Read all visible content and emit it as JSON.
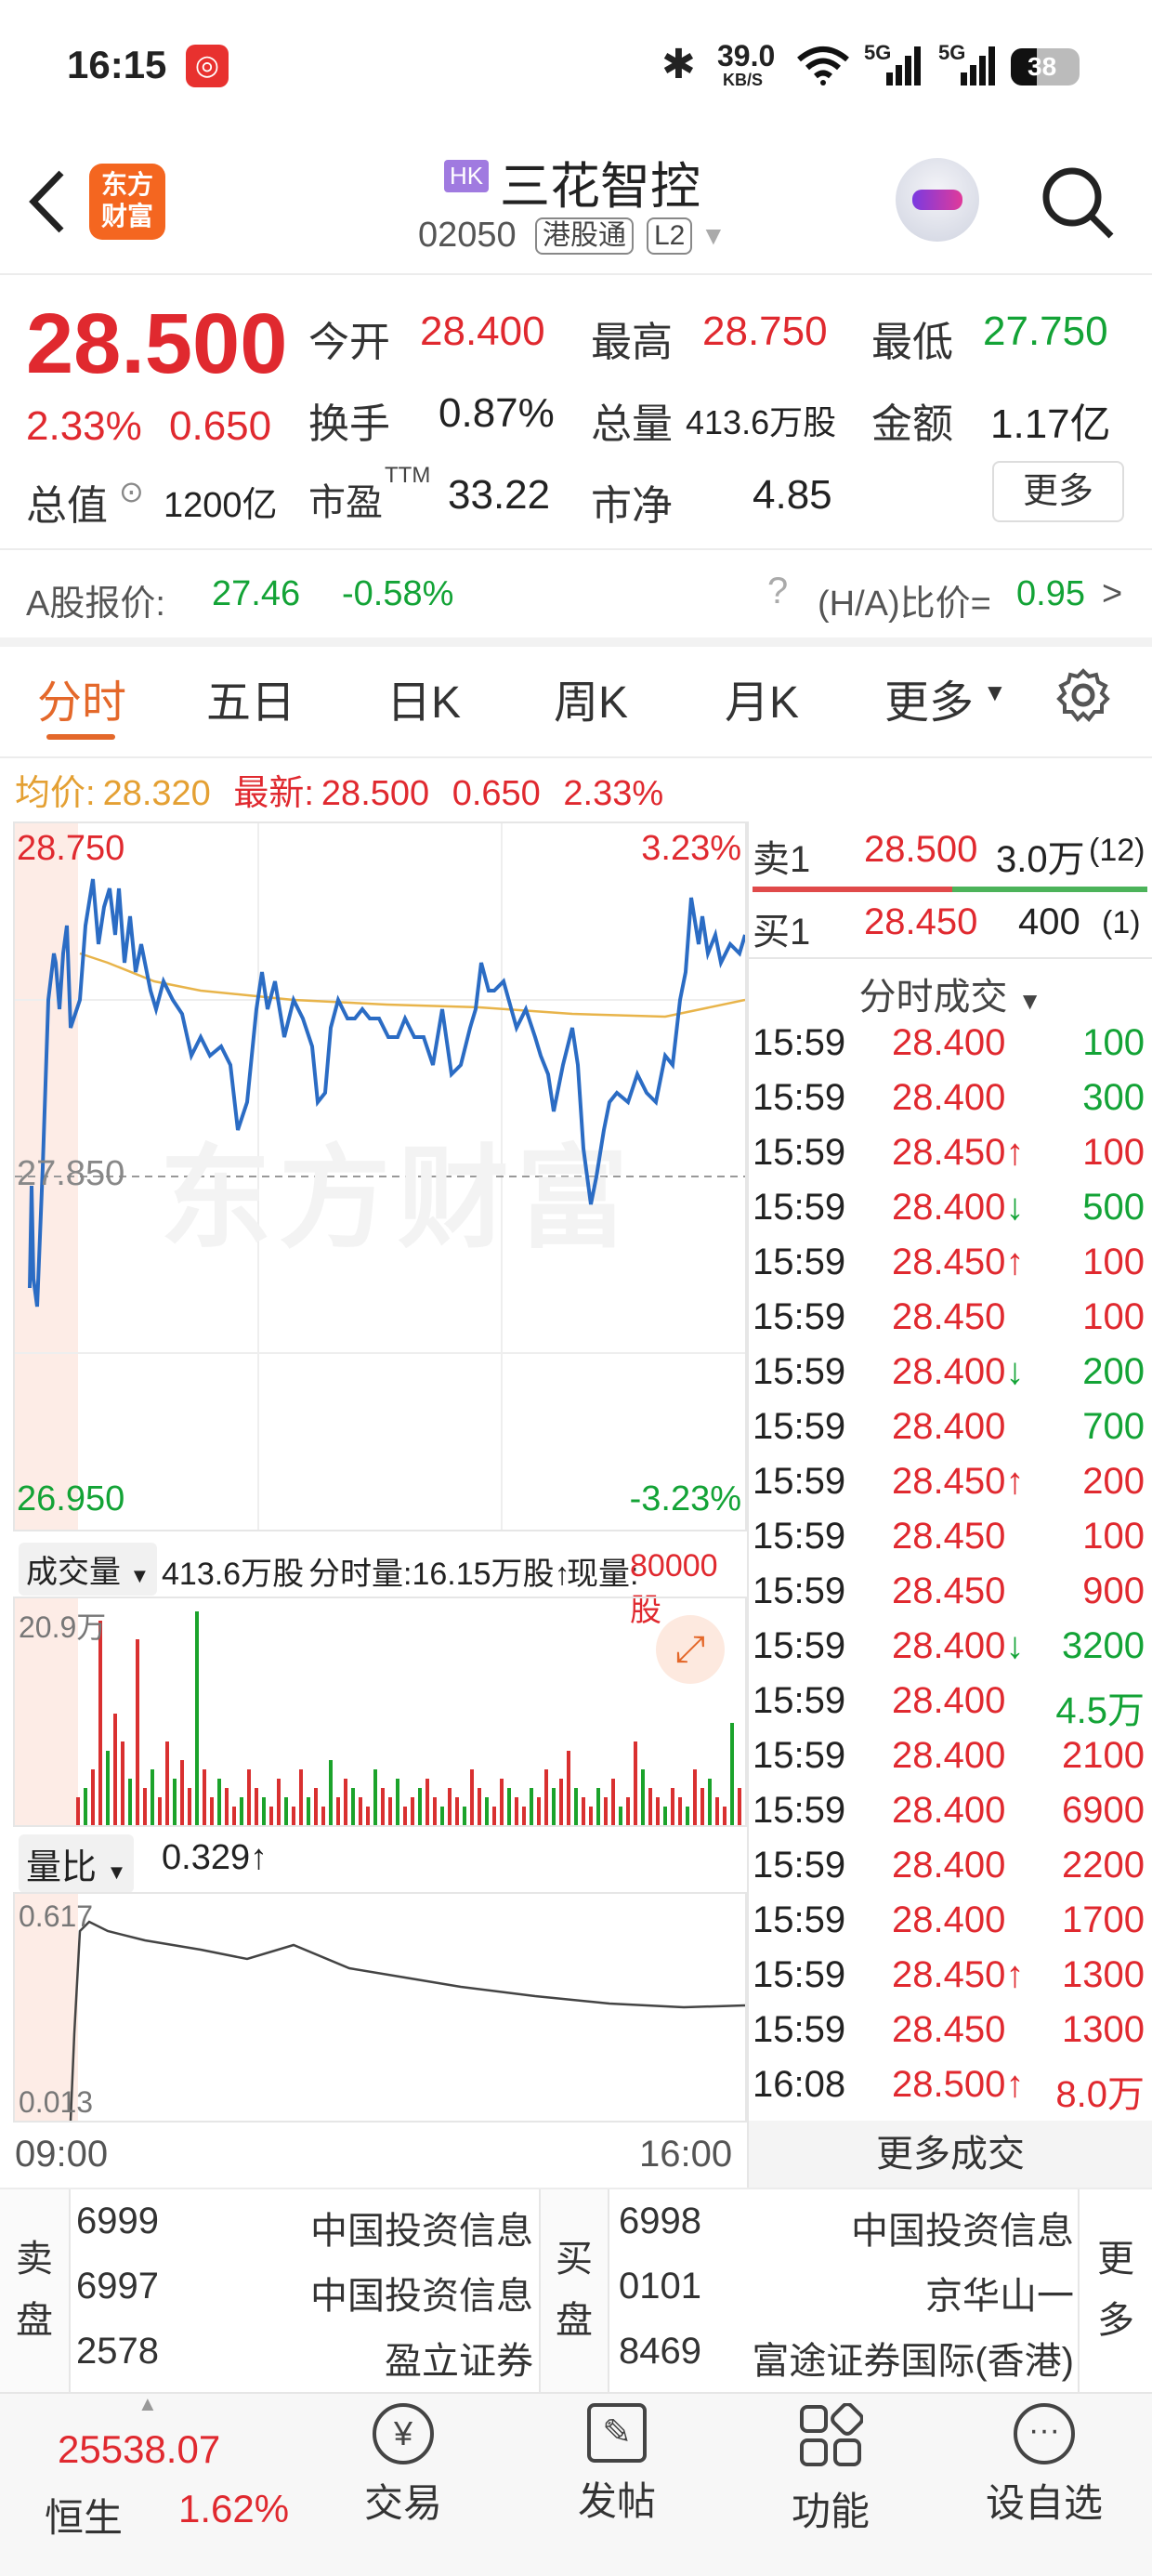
{
  "status_bar": {
    "time": "16:15",
    "net_speed": "39.0",
    "net_unit": "KB/S",
    "sig1": "5G",
    "sig2": "5G",
    "battery": "38"
  },
  "header": {
    "logo_line1": "东方",
    "logo_line2": "财富",
    "market_badge": "HK",
    "stock_name": "三花智控",
    "stock_code": "02050",
    "tag1": "港股通",
    "tag2": "L2"
  },
  "quote": {
    "price": "28.500",
    "change_pct": "2.33%",
    "change_amt": "0.650",
    "open_label": "今开",
    "open": "28.400",
    "high_label": "最高",
    "high": "28.750",
    "low_label": "最低",
    "low": "27.750",
    "turnover_label": "换手",
    "turnover": "0.87%",
    "volume_label": "总量",
    "volume": "413.6万股",
    "amount_label": "金额",
    "amount": "1.17亿",
    "mktcap_label": "总值",
    "mktcap": "1200亿",
    "pe_label": "市盈",
    "pe_sup": "TTM",
    "pe": "33.22",
    "pb_label": "市净",
    "pb": "4.85",
    "more": "更多"
  },
  "a_share": {
    "label": "A股报价:",
    "price": "27.46",
    "change": "-0.58%",
    "ratio_label": "(H/A)比价=",
    "ratio": "0.95",
    ">": ">"
  },
  "tabs": [
    "分时",
    "五日",
    "日K",
    "周K",
    "月K",
    "更多"
  ],
  "chart_info": {
    "avg_label": "均价:",
    "avg": "28.320",
    "last_label": "最新:",
    "last": "28.500",
    "chg": "0.650",
    "pct": "2.33%"
  },
  "chart_labels": {
    "top_price": "28.750",
    "top_pct": "3.23%",
    "mid_price": "27.850",
    "bottom_price": "26.950",
    "bottom_pct": "-3.23%",
    "start_time": "09:00",
    "end_time": "16:00"
  },
  "volume_bar": {
    "label": "成交量",
    "total": "413.6万股",
    "minute": "分时量:16.15万股↑",
    "now_label": "现量:",
    "now": "80000股",
    "max": "20.9万"
  },
  "ratio_bar": {
    "label": "量比",
    "value": "0.329↑",
    "top": "0.617",
    "bottom": "0.013"
  },
  "order_book": {
    "sell": {
      "label": "卖1",
      "price": "28.500",
      "vol": "3.0万",
      "count": "(12)"
    },
    "buy": {
      "label": "买1",
      "price": "28.450",
      "vol": "400",
      "count": "(1)"
    }
  },
  "trades_title": "分时成交",
  "trades": [
    {
      "t": "15:59",
      "p": "28.400",
      "a": "",
      "v": "100",
      "c": "green"
    },
    {
      "t": "15:59",
      "p": "28.400",
      "a": "",
      "v": "300",
      "c": "green"
    },
    {
      "t": "15:59",
      "p": "28.450",
      "a": "↑",
      "v": "100",
      "c": "red"
    },
    {
      "t": "15:59",
      "p": "28.400",
      "a": "↓",
      "v": "500",
      "c": "green"
    },
    {
      "t": "15:59",
      "p": "28.450",
      "a": "↑",
      "v": "100",
      "c": "red"
    },
    {
      "t": "15:59",
      "p": "28.450",
      "a": "",
      "v": "100",
      "c": "red"
    },
    {
      "t": "15:59",
      "p": "28.400",
      "a": "↓",
      "v": "200",
      "c": "green"
    },
    {
      "t": "15:59",
      "p": "28.400",
      "a": "",
      "v": "700",
      "c": "green"
    },
    {
      "t": "15:59",
      "p": "28.450",
      "a": "↑",
      "v": "200",
      "c": "red"
    },
    {
      "t": "15:59",
      "p": "28.450",
      "a": "",
      "v": "100",
      "c": "red"
    },
    {
      "t": "15:59",
      "p": "28.450",
      "a": "",
      "v": "900",
      "c": "red"
    },
    {
      "t": "15:59",
      "p": "28.400",
      "a": "↓",
      "v": "3200",
      "c": "green"
    },
    {
      "t": "15:59",
      "p": "28.400",
      "a": "",
      "v": "4.5万",
      "c": "green"
    },
    {
      "t": "15:59",
      "p": "28.400",
      "a": "",
      "v": "2100",
      "c": "red"
    },
    {
      "t": "15:59",
      "p": "28.400",
      "a": "",
      "v": "6900",
      "c": "red"
    },
    {
      "t": "15:59",
      "p": "28.400",
      "a": "",
      "v": "2200",
      "c": "red"
    },
    {
      "t": "15:59",
      "p": "28.400",
      "a": "",
      "v": "1700",
      "c": "red"
    },
    {
      "t": "15:59",
      "p": "28.450",
      "a": "↑",
      "v": "1300",
      "c": "red"
    },
    {
      "t": "15:59",
      "p": "28.450",
      "a": "",
      "v": "1300",
      "c": "red"
    },
    {
      "t": "16:08",
      "p": "28.500",
      "a": "↑",
      "v": "8.0万",
      "c": "red"
    }
  ],
  "more_trades": "更多成交",
  "brokers": {
    "sell_label1": "卖",
    "sell_label2": "盘",
    "buy_label1": "买",
    "buy_label2": "盘",
    "more1": "更",
    "more2": "多",
    "sell": [
      {
        "code": "6999",
        "name": "中国投资信息"
      },
      {
        "code": "6997",
        "name": "中国投资信息"
      },
      {
        "code": "2578",
        "name": "盈立证券"
      }
    ],
    "buy": [
      {
        "code": "6998",
        "name": "中国投资信息"
      },
      {
        "code": "0101",
        "name": "京华山一"
      },
      {
        "code": "8469",
        "name": "富途证券国际(香港)"
      }
    ]
  },
  "bottom_nav": {
    "index_value": "25538.07",
    "index_name": "恒生",
    "index_pct": "1.62%",
    "trade": "交易",
    "post": "发帖",
    "func": "功能",
    "watch": "设自选"
  },
  "watermark": "东方财富"
}
